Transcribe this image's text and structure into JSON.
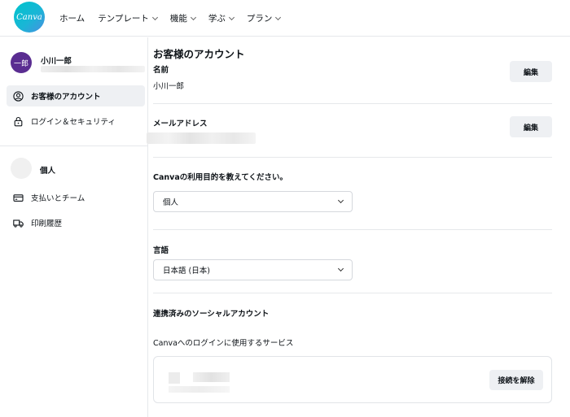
{
  "logo": {
    "text": "Canva"
  },
  "nav": {
    "home": "ホーム",
    "templates": "テンプレート",
    "features": "機能",
    "learn": "学ぶ",
    "plans": "プラン"
  },
  "sidebar": {
    "avatar_text": "一郎",
    "user_name": "小川一郎",
    "items": [
      {
        "label": "お客様のアカウント",
        "icon": "user-circle-icon"
      },
      {
        "label": "ログイン＆セキュリティ",
        "icon": "lock-icon"
      }
    ],
    "team_name": "個人",
    "team_items": [
      {
        "label": "支払いとチーム",
        "icon": "credit-card-icon"
      },
      {
        "label": "印刷履歴",
        "icon": "truck-icon"
      }
    ]
  },
  "main": {
    "title": "お客様のアカウント",
    "name_label": "名前",
    "name_value": "小川一郎",
    "edit_label": "編集",
    "email_label": "メールアドレス",
    "purpose_label": "Canvaの利用目的を教えてください。",
    "purpose_value": "個人",
    "language_label": "言語",
    "language_value": "日本語 (日本)",
    "social_title": "連携済みのソーシャルアカウント",
    "social_desc": "Canvaへのログインに使用するサービス",
    "disconnect_label": "接続を解除"
  },
  "colors": {
    "brand": "#00c4cc",
    "avatar": "#5a2d91",
    "active_bg": "#eef0f3"
  }
}
